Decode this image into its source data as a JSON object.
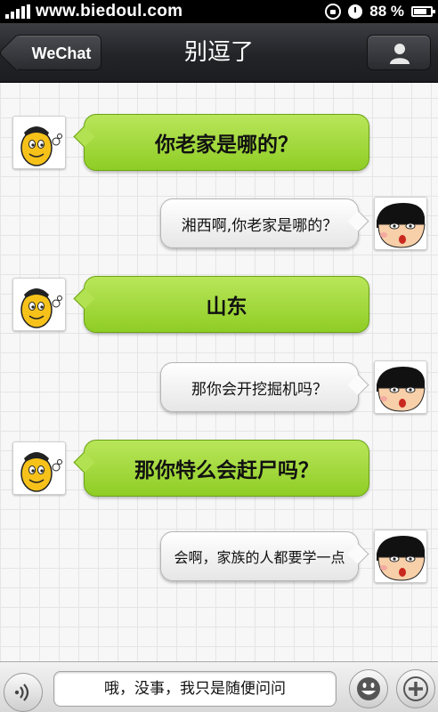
{
  "status_bar": {
    "site": "www.biedoul.com",
    "battery": "88 %"
  },
  "nav": {
    "back_label": "WeChat",
    "title": "别逗了"
  },
  "messages": [
    {
      "side": "left",
      "text": "你老家是哪的？",
      "avatar": "yellow-egg-avatar"
    },
    {
      "side": "right",
      "text": "湘西啊,你老家是哪的？",
      "avatar": "crayon-shin-chan-avatar"
    },
    {
      "side": "left",
      "text": "山东",
      "avatar": "yellow-egg-avatar"
    },
    {
      "side": "right",
      "text": "那你会开挖掘机吗？",
      "avatar": "crayon-shin-chan-avatar"
    },
    {
      "side": "left",
      "text": "那你特么会赶尸吗？",
      "avatar": "yellow-egg-avatar"
    },
    {
      "side": "right",
      "text": "会啊，家族的人都要学一点",
      "avatar": "crayon-shin-chan-avatar"
    }
  ],
  "input": {
    "value": "哦，没事，我只是随便问问"
  },
  "colors": {
    "incoming_bubble": "#9fd63a",
    "outgoing_bubble": "#f2f2f2",
    "nav_bar": "#2a2b30"
  }
}
